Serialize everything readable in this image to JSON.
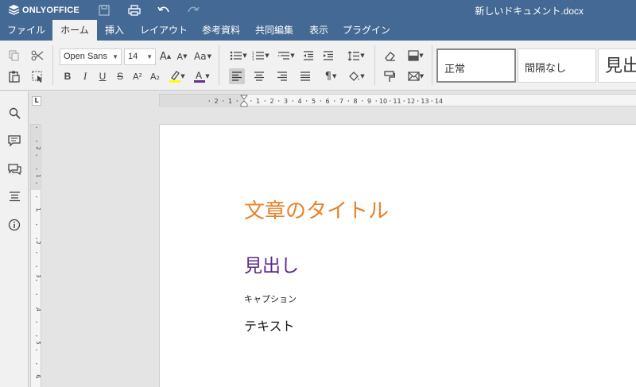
{
  "app": {
    "logo_text": "ONLYOFFICE",
    "document_title": "新しいドキュメント.docx"
  },
  "menu": {
    "tabs": [
      {
        "label": "ファイル"
      },
      {
        "label": "ホーム"
      },
      {
        "label": "挿入"
      },
      {
        "label": "レイアウト"
      },
      {
        "label": "参考資料"
      },
      {
        "label": "共同編集"
      },
      {
        "label": "表示"
      },
      {
        "label": "プラグイン"
      }
    ],
    "active_tab": "ホーム"
  },
  "toolbar": {
    "font_name": "Open Sans",
    "font_size": "14",
    "change_case_label": "Aa",
    "bold_label": "B",
    "italic_label": "I",
    "underline_label": "U",
    "strike_label": "S",
    "superscript_label": "A²",
    "subscript_label": "A₂",
    "grow_font_label": "A",
    "shrink_font_label": "A",
    "highlight_color": "#ffff00",
    "font_color": "#6a2c91",
    "styles": [
      {
        "label": "正常"
      },
      {
        "label": "間隔なし"
      },
      {
        "label": "見出"
      }
    ]
  },
  "ruler": {
    "corner_label": "L",
    "horizontal_labels": [
      "2",
      "1",
      "1",
      "2",
      "3",
      "4",
      "5",
      "6",
      "7",
      "8",
      "9",
      "10",
      "11",
      "12",
      "13",
      "14"
    ],
    "vertical_labels": [
      "2",
      "1",
      "1",
      "2",
      "3",
      "4",
      "5",
      "6"
    ]
  },
  "document": {
    "title": "文章のタイトル",
    "heading": "見出し",
    "caption": "キャプション",
    "body": "テキスト"
  },
  "colors": {
    "header_bg": "#446995",
    "title_color": "#e8822b",
    "heading_color": "#5b2a86"
  }
}
